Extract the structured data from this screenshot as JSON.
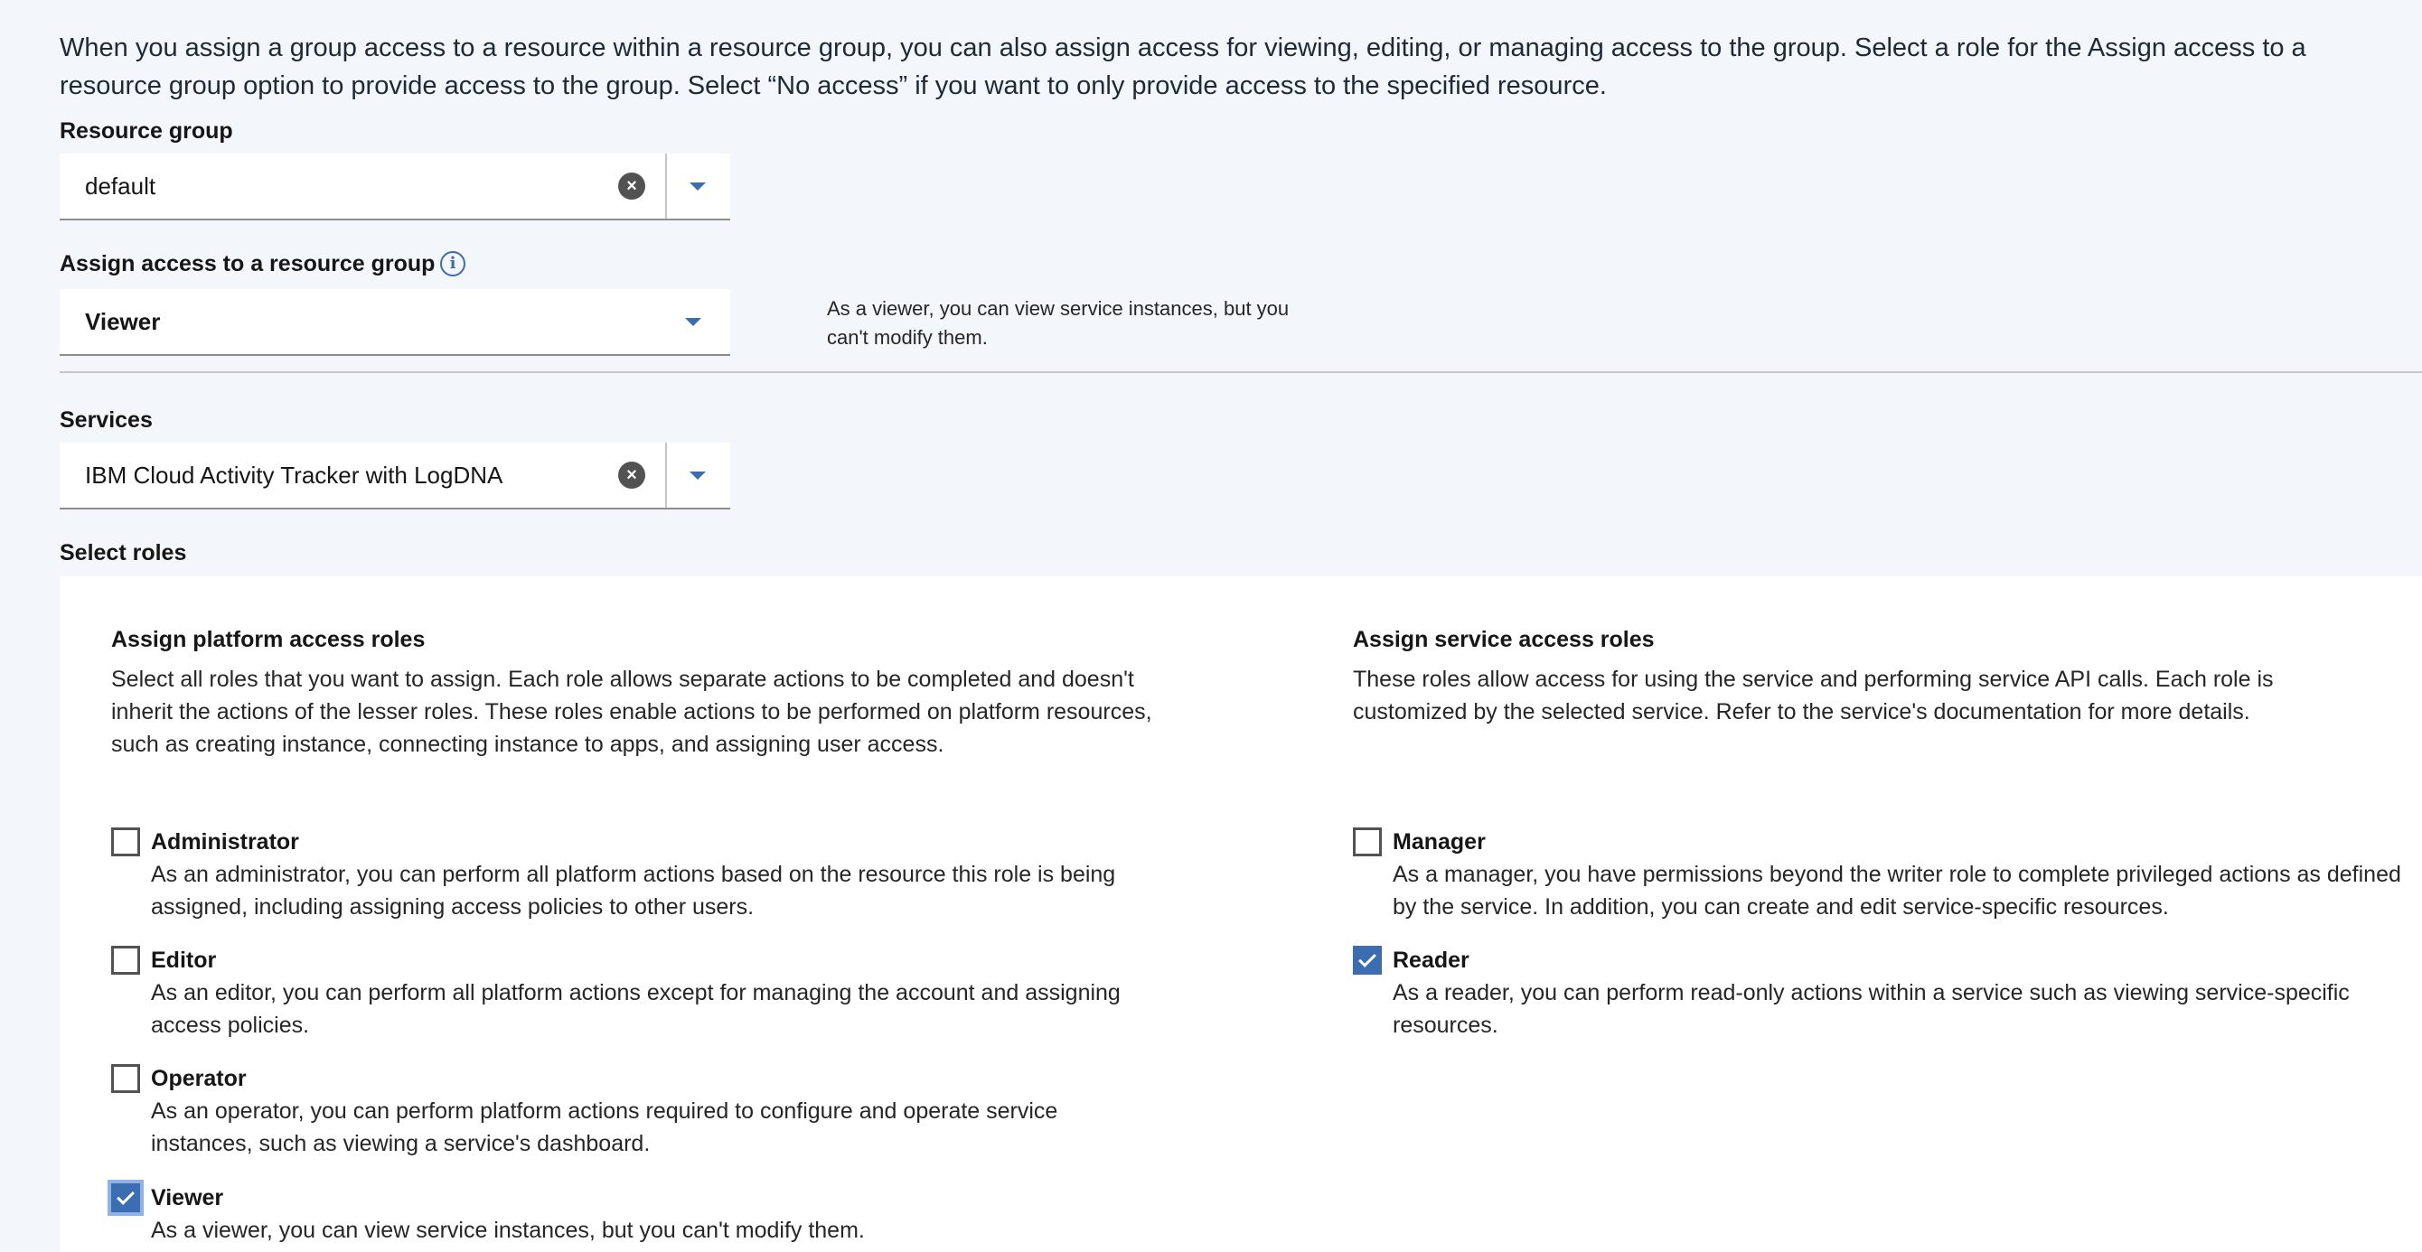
{
  "intro_text": "When you assign a group access to a resource within a resource group, you can also assign access for viewing, editing, or managing access to the group. Select a role for the Assign access to a resource group option to provide access to the group. Select “No access” if you want to only provide access to the specified resource.",
  "resource_group": {
    "label": "Resource group",
    "value": "default"
  },
  "assign_access": {
    "label": "Assign access to a resource group",
    "value": "Viewer",
    "helper": "As a viewer, you can view service instances, but you can't modify them."
  },
  "services": {
    "label": "Services",
    "value": "IBM Cloud Activity Tracker with LogDNA"
  },
  "select_roles": {
    "label": "Select roles",
    "platform": {
      "title": "Assign platform access roles",
      "description": "Select all roles that you want to assign. Each role allows separate actions to be completed and doesn't inherit the actions of the lesser roles. These roles enable actions to be performed on platform resources, such as creating instance, connecting instance to apps, and assigning user access.",
      "roles": [
        {
          "name": "Administrator",
          "description": "As an administrator, you can perform all platform actions based on the resource this role is being assigned, including assigning access policies to other users.",
          "checked": false
        },
        {
          "name": "Editor",
          "description": "As an editor, you can perform all platform actions except for managing the account and assigning access policies.",
          "checked": false
        },
        {
          "name": "Operator",
          "description": "As an operator, you can perform platform actions required to configure and operate service instances, such as viewing a service's dashboard.",
          "checked": false
        },
        {
          "name": "Viewer",
          "description": "As a viewer, you can view service instances, but you can't modify them.",
          "checked": true
        }
      ]
    },
    "service": {
      "title": "Assign service access roles",
      "description": "These roles allow access for using the service and performing service API calls. Each role is customized by the selected service. Refer to the service's documentation for more details.",
      "roles": [
        {
          "name": "Manager",
          "description": "As a manager, you have permissions beyond the writer role to complete privileged actions as defined by the service. In addition, you can create and edit service-specific resources.",
          "checked": false
        },
        {
          "name": "Reader",
          "description": "As a reader, you can perform read-only actions within a service such as viewing service-specific resources.",
          "checked": true
        }
      ]
    }
  },
  "colors": {
    "accent": "#3b6db3",
    "background": "#f3f6fa",
    "panel": "#ffffff"
  }
}
